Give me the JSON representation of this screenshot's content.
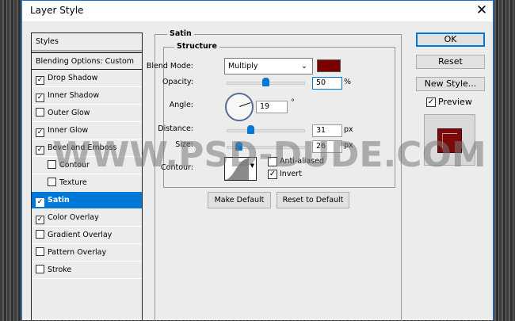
{
  "window": {
    "title": "Layer Style",
    "close": "✕"
  },
  "styles_panel": {
    "header": "Styles",
    "blending": "Blending Options: Custom",
    "items": [
      {
        "label": "Drop Shadow",
        "checked": true,
        "indent": false
      },
      {
        "label": "Inner Shadow",
        "checked": true,
        "indent": false
      },
      {
        "label": "Outer Glow",
        "checked": false,
        "indent": false
      },
      {
        "label": "Inner Glow",
        "checked": true,
        "indent": false
      },
      {
        "label": "Bevel and Emboss",
        "checked": true,
        "indent": false
      },
      {
        "label": "Contour",
        "checked": false,
        "indent": true
      },
      {
        "label": "Texture",
        "checked": false,
        "indent": true
      },
      {
        "label": "Satin",
        "checked": true,
        "indent": false,
        "selected": true
      },
      {
        "label": "Color Overlay",
        "checked": true,
        "indent": false
      },
      {
        "label": "Gradient Overlay",
        "checked": false,
        "indent": false
      },
      {
        "label": "Pattern Overlay",
        "checked": false,
        "indent": false
      },
      {
        "label": "Stroke",
        "checked": false,
        "indent": false
      }
    ]
  },
  "satin": {
    "title": "Satin",
    "structure": "Structure",
    "blend_mode_label": "Blend Mode:",
    "blend_mode": "Multiply",
    "color": "#7a0000",
    "opacity_label": "Opacity:",
    "opacity": "50",
    "opacity_unit": "%",
    "angle_label": "Angle:",
    "angle": "19",
    "angle_unit": "°",
    "distance_label": "Distance:",
    "distance": "31",
    "distance_unit": "px",
    "size_label": "Size:",
    "size": "26",
    "size_unit": "px",
    "contour_label": "Contour:",
    "anti_aliased": "Anti-aliased",
    "anti_aliased_checked": false,
    "invert": "Invert",
    "invert_checked": true,
    "make_default": "Make Default",
    "reset_default": "Reset to Default"
  },
  "actions": {
    "ok": "OK",
    "reset": "Reset",
    "new_style": "New Style...",
    "preview": "Preview",
    "preview_checked": true
  },
  "watermark": "WWW.PSD-DUDE.COM",
  "accent": "#0078d7"
}
